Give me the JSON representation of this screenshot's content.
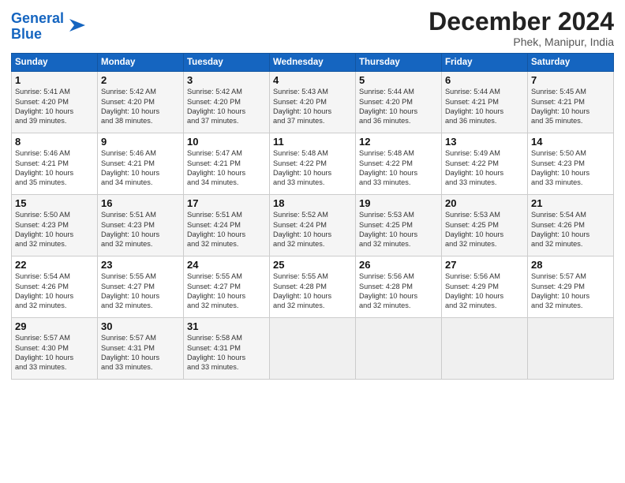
{
  "header": {
    "logo_line1": "General",
    "logo_line2": "Blue",
    "title": "December 2024",
    "subtitle": "Phek, Manipur, India"
  },
  "weekdays": [
    "Sunday",
    "Monday",
    "Tuesday",
    "Wednesday",
    "Thursday",
    "Friday",
    "Saturday"
  ],
  "weeks": [
    [
      {
        "day": "1",
        "lines": [
          "Sunrise: 5:41 AM",
          "Sunset: 4:20 PM",
          "Daylight: 10 hours",
          "and 39 minutes."
        ]
      },
      {
        "day": "2",
        "lines": [
          "Sunrise: 5:42 AM",
          "Sunset: 4:20 PM",
          "Daylight: 10 hours",
          "and 38 minutes."
        ]
      },
      {
        "day": "3",
        "lines": [
          "Sunrise: 5:42 AM",
          "Sunset: 4:20 PM",
          "Daylight: 10 hours",
          "and 37 minutes."
        ]
      },
      {
        "day": "4",
        "lines": [
          "Sunrise: 5:43 AM",
          "Sunset: 4:20 PM",
          "Daylight: 10 hours",
          "and 37 minutes."
        ]
      },
      {
        "day": "5",
        "lines": [
          "Sunrise: 5:44 AM",
          "Sunset: 4:20 PM",
          "Daylight: 10 hours",
          "and 36 minutes."
        ]
      },
      {
        "day": "6",
        "lines": [
          "Sunrise: 5:44 AM",
          "Sunset: 4:21 PM",
          "Daylight: 10 hours",
          "and 36 minutes."
        ]
      },
      {
        "day": "7",
        "lines": [
          "Sunrise: 5:45 AM",
          "Sunset: 4:21 PM",
          "Daylight: 10 hours",
          "and 35 minutes."
        ]
      }
    ],
    [
      {
        "day": "8",
        "lines": [
          "Sunrise: 5:46 AM",
          "Sunset: 4:21 PM",
          "Daylight: 10 hours",
          "and 35 minutes."
        ]
      },
      {
        "day": "9",
        "lines": [
          "Sunrise: 5:46 AM",
          "Sunset: 4:21 PM",
          "Daylight: 10 hours",
          "and 34 minutes."
        ]
      },
      {
        "day": "10",
        "lines": [
          "Sunrise: 5:47 AM",
          "Sunset: 4:21 PM",
          "Daylight: 10 hours",
          "and 34 minutes."
        ]
      },
      {
        "day": "11",
        "lines": [
          "Sunrise: 5:48 AM",
          "Sunset: 4:22 PM",
          "Daylight: 10 hours",
          "and 33 minutes."
        ]
      },
      {
        "day": "12",
        "lines": [
          "Sunrise: 5:48 AM",
          "Sunset: 4:22 PM",
          "Daylight: 10 hours",
          "and 33 minutes."
        ]
      },
      {
        "day": "13",
        "lines": [
          "Sunrise: 5:49 AM",
          "Sunset: 4:22 PM",
          "Daylight: 10 hours",
          "and 33 minutes."
        ]
      },
      {
        "day": "14",
        "lines": [
          "Sunrise: 5:50 AM",
          "Sunset: 4:23 PM",
          "Daylight: 10 hours",
          "and 33 minutes."
        ]
      }
    ],
    [
      {
        "day": "15",
        "lines": [
          "Sunrise: 5:50 AM",
          "Sunset: 4:23 PM",
          "Daylight: 10 hours",
          "and 32 minutes."
        ]
      },
      {
        "day": "16",
        "lines": [
          "Sunrise: 5:51 AM",
          "Sunset: 4:23 PM",
          "Daylight: 10 hours",
          "and 32 minutes."
        ]
      },
      {
        "day": "17",
        "lines": [
          "Sunrise: 5:51 AM",
          "Sunset: 4:24 PM",
          "Daylight: 10 hours",
          "and 32 minutes."
        ]
      },
      {
        "day": "18",
        "lines": [
          "Sunrise: 5:52 AM",
          "Sunset: 4:24 PM",
          "Daylight: 10 hours",
          "and 32 minutes."
        ]
      },
      {
        "day": "19",
        "lines": [
          "Sunrise: 5:53 AM",
          "Sunset: 4:25 PM",
          "Daylight: 10 hours",
          "and 32 minutes."
        ]
      },
      {
        "day": "20",
        "lines": [
          "Sunrise: 5:53 AM",
          "Sunset: 4:25 PM",
          "Daylight: 10 hours",
          "and 32 minutes."
        ]
      },
      {
        "day": "21",
        "lines": [
          "Sunrise: 5:54 AM",
          "Sunset: 4:26 PM",
          "Daylight: 10 hours",
          "and 32 minutes."
        ]
      }
    ],
    [
      {
        "day": "22",
        "lines": [
          "Sunrise: 5:54 AM",
          "Sunset: 4:26 PM",
          "Daylight: 10 hours",
          "and 32 minutes."
        ]
      },
      {
        "day": "23",
        "lines": [
          "Sunrise: 5:55 AM",
          "Sunset: 4:27 PM",
          "Daylight: 10 hours",
          "and 32 minutes."
        ]
      },
      {
        "day": "24",
        "lines": [
          "Sunrise: 5:55 AM",
          "Sunset: 4:27 PM",
          "Daylight: 10 hours",
          "and 32 minutes."
        ]
      },
      {
        "day": "25",
        "lines": [
          "Sunrise: 5:55 AM",
          "Sunset: 4:28 PM",
          "Daylight: 10 hours",
          "and 32 minutes."
        ]
      },
      {
        "day": "26",
        "lines": [
          "Sunrise: 5:56 AM",
          "Sunset: 4:28 PM",
          "Daylight: 10 hours",
          "and 32 minutes."
        ]
      },
      {
        "day": "27",
        "lines": [
          "Sunrise: 5:56 AM",
          "Sunset: 4:29 PM",
          "Daylight: 10 hours",
          "and 32 minutes."
        ]
      },
      {
        "day": "28",
        "lines": [
          "Sunrise: 5:57 AM",
          "Sunset: 4:29 PM",
          "Daylight: 10 hours",
          "and 32 minutes."
        ]
      }
    ],
    [
      {
        "day": "29",
        "lines": [
          "Sunrise: 5:57 AM",
          "Sunset: 4:30 PM",
          "Daylight: 10 hours",
          "and 33 minutes."
        ]
      },
      {
        "day": "30",
        "lines": [
          "Sunrise: 5:57 AM",
          "Sunset: 4:31 PM",
          "Daylight: 10 hours",
          "and 33 minutes."
        ]
      },
      {
        "day": "31",
        "lines": [
          "Sunrise: 5:58 AM",
          "Sunset: 4:31 PM",
          "Daylight: 10 hours",
          "and 33 minutes."
        ]
      },
      {
        "day": "",
        "lines": []
      },
      {
        "day": "",
        "lines": []
      },
      {
        "day": "",
        "lines": []
      },
      {
        "day": "",
        "lines": []
      }
    ]
  ]
}
